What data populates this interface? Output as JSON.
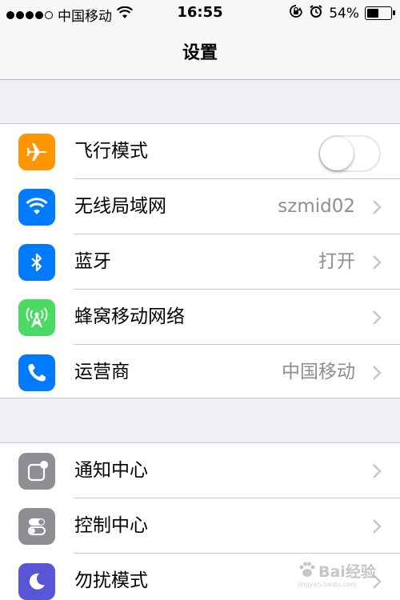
{
  "status_bar": {
    "carrier": "中国移动",
    "time": "16:55",
    "battery_percent": "54%",
    "battery_level": 0.54,
    "signal_bars_filled": 4,
    "signal_bars_total": 5,
    "icons": [
      "wifi-icon",
      "rotation-lock-icon",
      "alarm-icon",
      "battery-icon"
    ]
  },
  "nav": {
    "title": "设置"
  },
  "groups": [
    {
      "rows": [
        {
          "label": "飞行模式",
          "value": "",
          "icon": "airplane-icon",
          "icon_color": "#ff9500",
          "toggle_on": false
        },
        {
          "label": "无线局域网",
          "value": "szmid02",
          "icon": "wifi-icon",
          "icon_color": "#007aff"
        },
        {
          "label": "蓝牙",
          "value": "打开",
          "icon": "bluetooth-icon",
          "icon_color": "#007aff"
        },
        {
          "label": "蜂窝移动网络",
          "value": "",
          "icon": "cellular-icon",
          "icon_color": "#4cd964"
        },
        {
          "label": "运营商",
          "value": "中国移动",
          "icon": "phone-icon",
          "icon_color": "#007aff"
        }
      ]
    },
    {
      "rows": [
        {
          "label": "通知中心",
          "value": "",
          "icon": "notification-center-icon",
          "icon_color": "#8e8e93"
        },
        {
          "label": "控制中心",
          "value": "",
          "icon": "control-center-icon",
          "icon_color": "#8e8e93"
        },
        {
          "label": "勿扰模式",
          "value": "",
          "icon": "do-not-disturb-icon",
          "icon_color": "#5856d6"
        }
      ]
    }
  ],
  "watermark": {
    "brand": "Bai经验",
    "url": "jingyan.baidu.com",
    "logo": "baidu-paw-icon"
  }
}
